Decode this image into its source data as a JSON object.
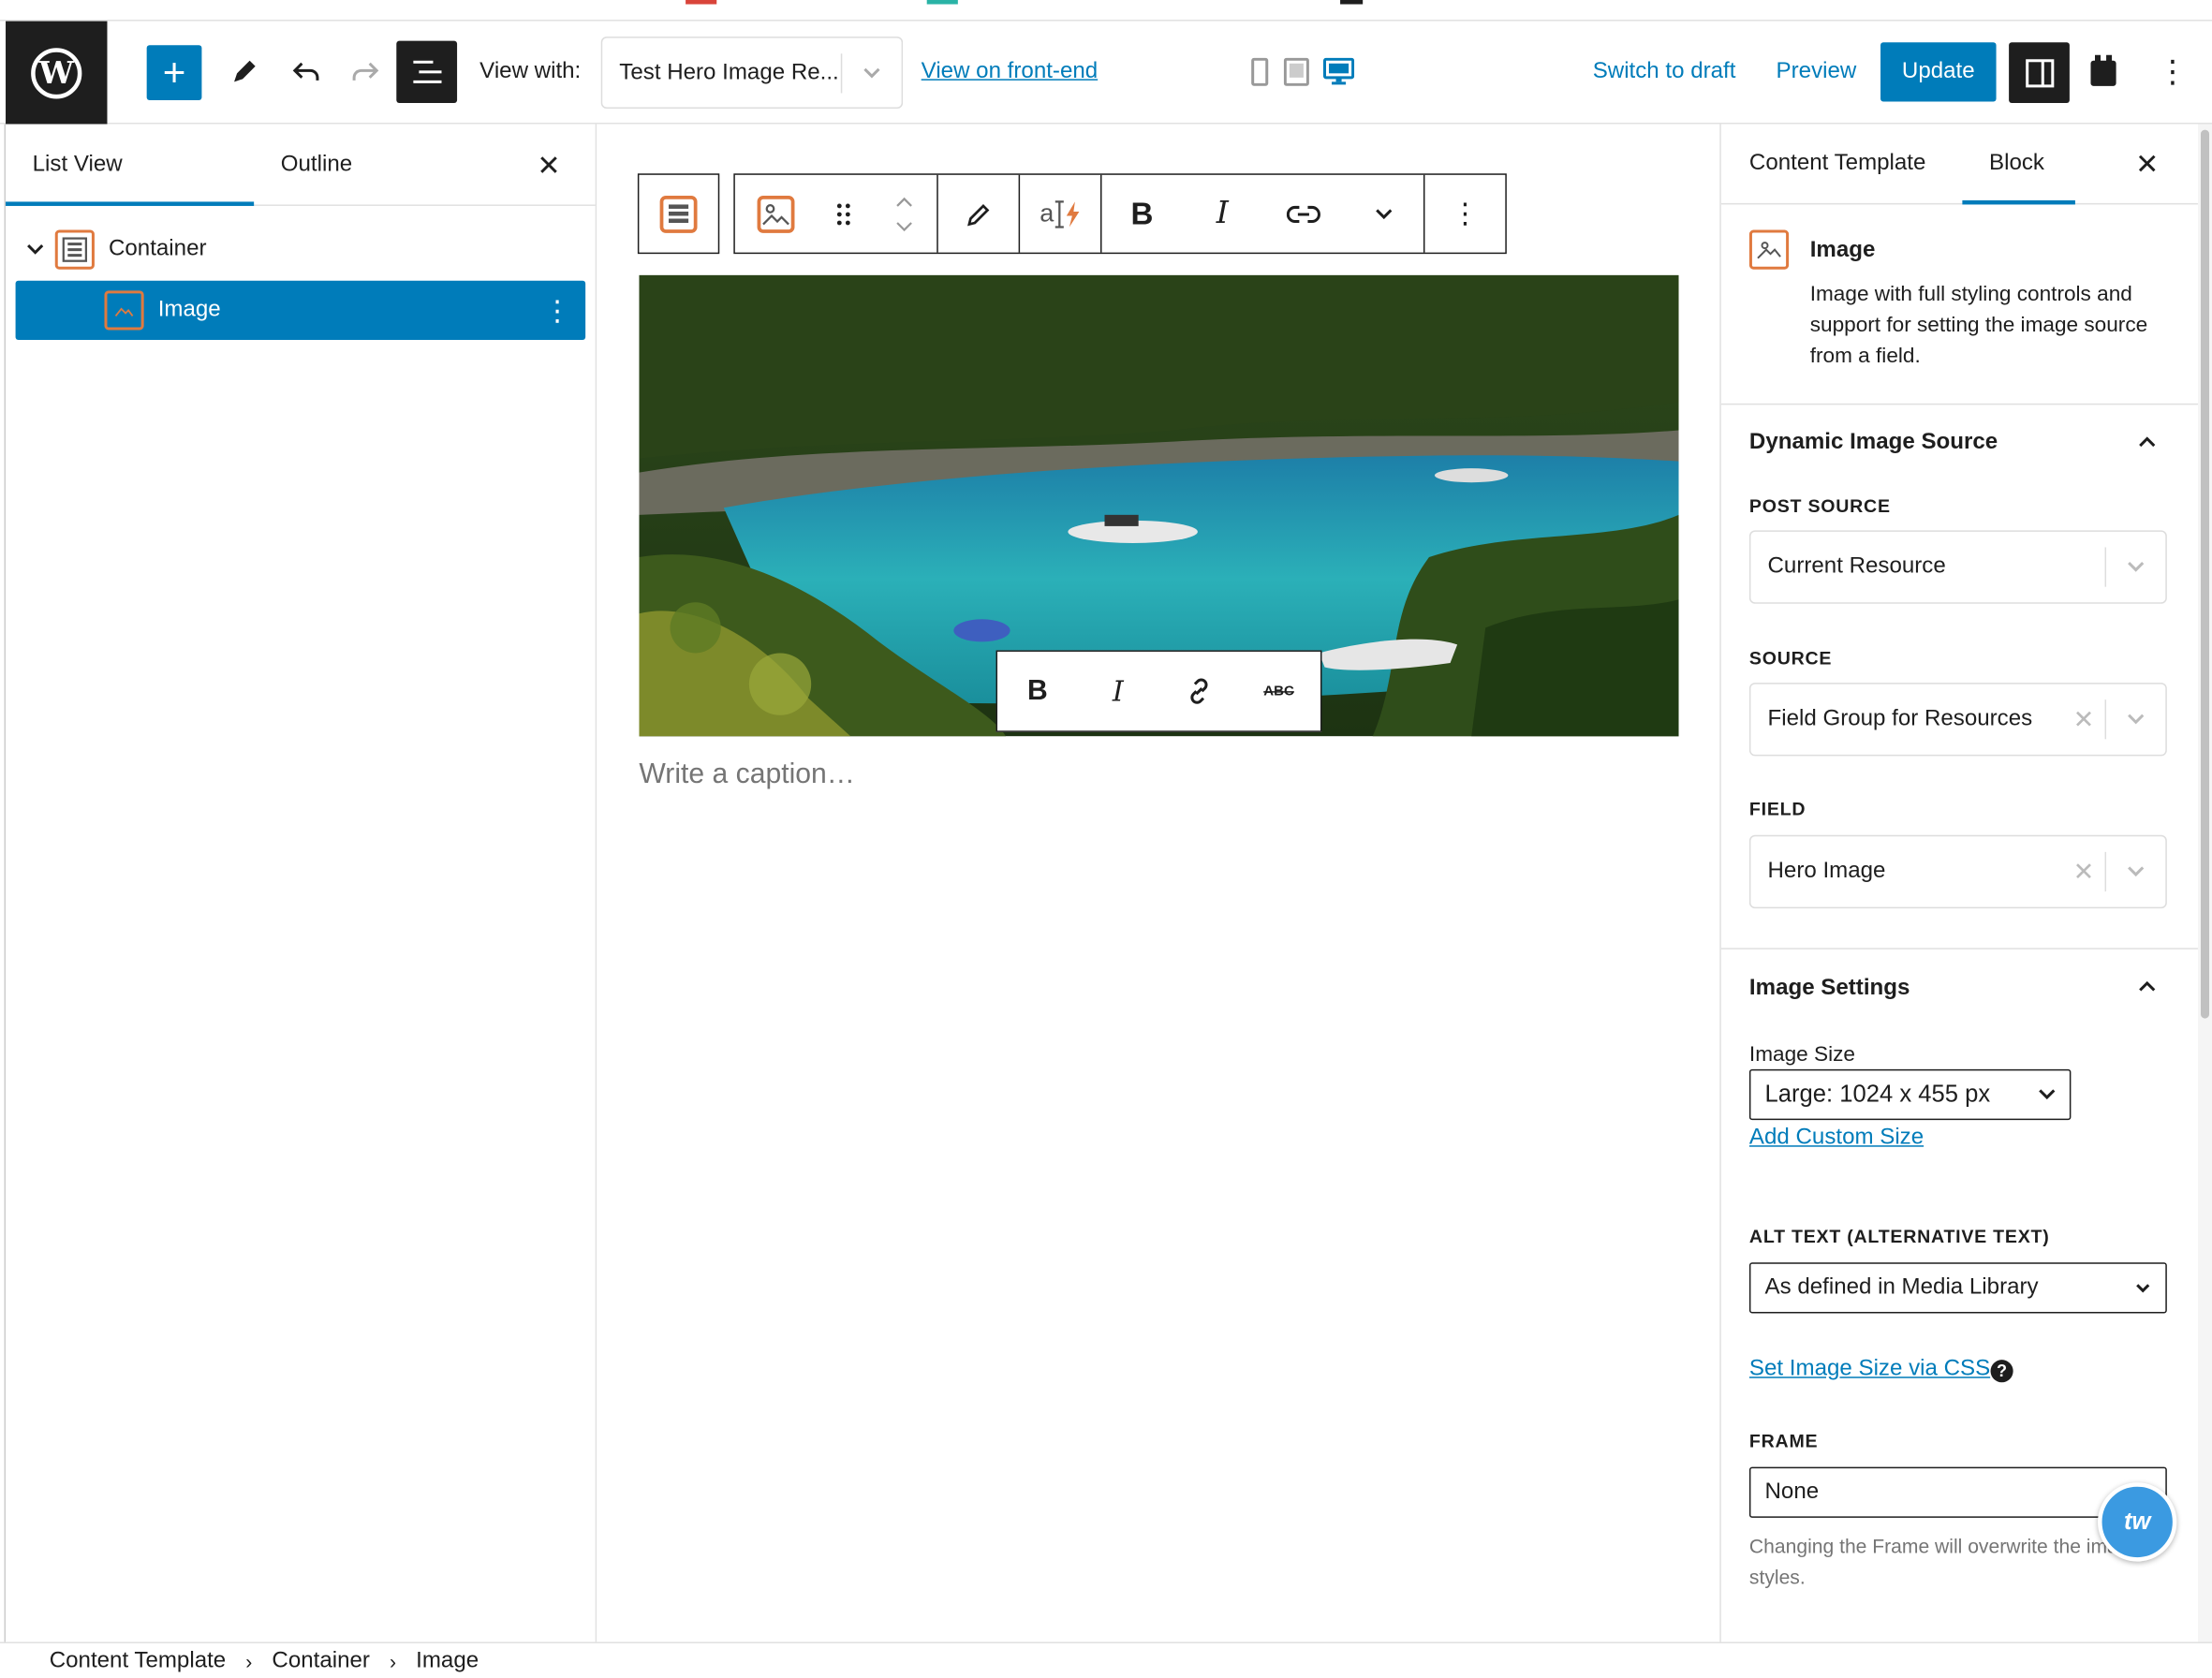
{
  "topbar": {
    "view_with_label": "View with:",
    "view_with_value": "Test Hero Image Re...",
    "view_frontend_link": "View on front-end",
    "switch_to_draft": "Switch to draft",
    "preview": "Preview",
    "update": "Update",
    "accent_color": "#007cba"
  },
  "left_panel": {
    "tabs": [
      "List View",
      "Outline"
    ],
    "tree": [
      {
        "label": "Container"
      },
      {
        "label": "Image"
      }
    ]
  },
  "canvas": {
    "caption_placeholder": "Write a caption…",
    "inline_toolbar": {
      "strike_label": "ABC"
    }
  },
  "sidebar": {
    "tabs": [
      "Content Template",
      "Block"
    ],
    "block": {
      "title": "Image",
      "description": "Image with full styling controls and support for setting the image source from a field."
    },
    "dynamic_source": {
      "heading": "Dynamic Image Source",
      "post_source_label": "POST SOURCE",
      "post_source_value": "Current Resource",
      "source_label": "SOURCE",
      "source_value": "Field Group for Resources",
      "field_label": "FIELD",
      "field_value": "Hero Image"
    },
    "image_settings": {
      "heading": "Image Settings",
      "image_size_label": "Image Size",
      "image_size_value": "Large: 1024 x 455 px",
      "add_custom_size": "Add Custom Size",
      "alt_text_label": "ALT TEXT (ALTERNATIVE TEXT)",
      "alt_text_value": "As defined in Media Library",
      "set_size_css": "Set Image Size via CSS",
      "frame_label": "FRAME",
      "frame_value": "None",
      "frame_help": "Changing the Frame will overwrite the image styles."
    },
    "chat_bubble": "tw"
  },
  "breadcrumb": [
    "Content Template",
    "Container",
    "Image"
  ]
}
